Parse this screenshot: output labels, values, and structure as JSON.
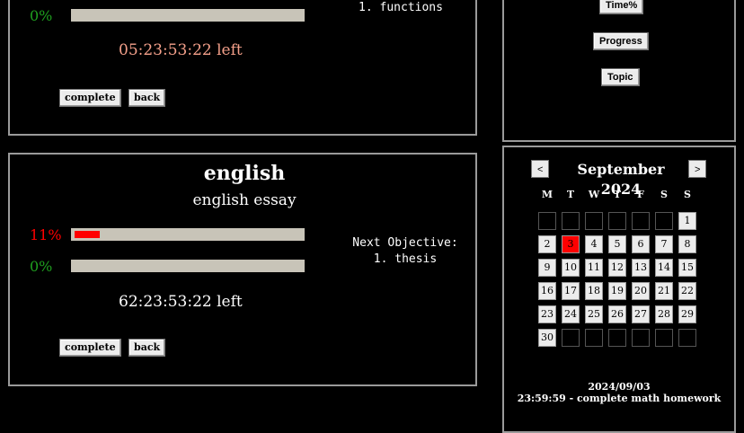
{
  "top_task": {
    "percent_bottom": "0%",
    "time_left": "05:23:53:22 left",
    "objective_item": "1. functions",
    "complete_label": "complete",
    "back_label": "back"
  },
  "english_task": {
    "title": "english",
    "subtitle": "english essay",
    "progress_percent": "11%",
    "progress_fraction": 0.11,
    "second_percent": "0%",
    "time_left": "62:23:53:22 left",
    "objective_heading": "Next Objective:",
    "objective_item": "1. thesis",
    "complete_label": "complete",
    "back_label": "back"
  },
  "side_buttons": {
    "time": "Time%",
    "progress": "Progress",
    "topic": "Topic"
  },
  "calendar": {
    "prev": "<",
    "next": ">",
    "month_label": "September 2024",
    "weekdays": [
      "M",
      "T",
      "W",
      "T",
      "F",
      "S",
      "S"
    ],
    "today": 3,
    "days_in_month": 30,
    "first_weekday_index": 6
  },
  "deadline": {
    "date": "2024/09/03",
    "text": "23:59:59 - complete math homework"
  },
  "colors": {
    "progress_fill": "#ff0000",
    "percent_red": "#ff0000",
    "percent_green": "#1f9f1f",
    "time_left_top": "#f4a08a",
    "today_highlight": "#ff0000"
  }
}
